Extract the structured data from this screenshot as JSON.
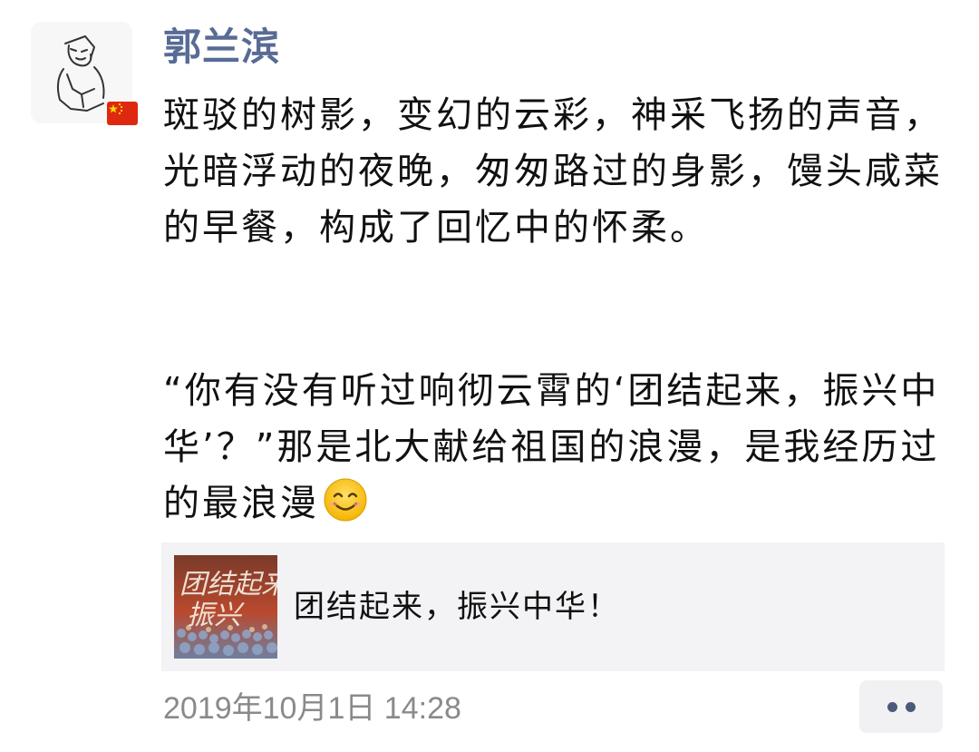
{
  "author": {
    "name": "郭兰滨"
  },
  "post": {
    "paragraph1": "斑驳的树影，变幻的云彩，神采飞扬的声音，光暗浮动的夜晚，匆匆路过的身影，馒头咸菜的早餐，构成了回忆中的怀柔。",
    "paragraph2": "“你有没有听过响彻云霄的‘团结起来，振兴中华’？”那是北大献给祖国的浪漫，是我经历过的最浪漫",
    "emoji": "smiling-face-emoji"
  },
  "link_card": {
    "title": "团结起来，振兴中华！",
    "thumbnail_text": "团结起来 振兴"
  },
  "meta": {
    "timestamp": "2019年10月1日 14:28"
  },
  "icons": {
    "avatar": "sketch-person-avatar",
    "badge": "china-flag-icon",
    "more": "more-dots-icon"
  },
  "colors": {
    "author_name": "#576b95",
    "link_card_bg": "#f3f3f5",
    "timestamp": "#8a8a8a",
    "flag_red": "#de2910",
    "flag_star": "#ffde00"
  }
}
